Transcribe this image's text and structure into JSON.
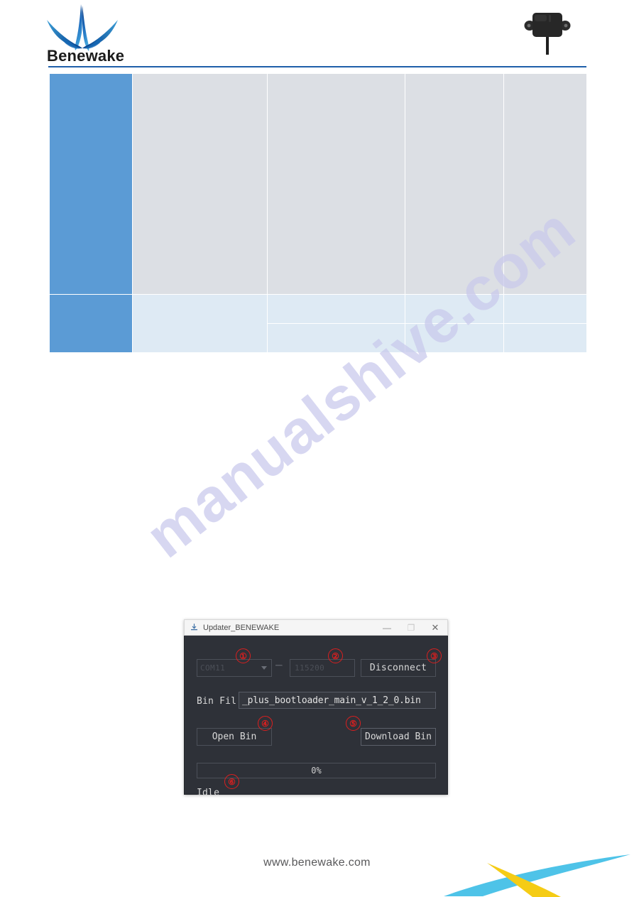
{
  "header": {
    "logo_wordmark": "Benewake",
    "logo_icon": "benewake-splash-logo",
    "device_icon": "lidar-sensor-device"
  },
  "watermark": {
    "text": "manualshive.com"
  },
  "table": {
    "columns": [
      "",
      "",
      "",
      "",
      ""
    ],
    "rows": [
      {
        "label": "",
        "cells": [
          "",
          "",
          "",
          ""
        ]
      },
      {
        "label": "",
        "cells": [
          "",
          "",
          "",
          ""
        ]
      }
    ]
  },
  "updater_dialog": {
    "title": "Updater_BENEWAKE",
    "title_icon": "updater-app-icon",
    "window_controls": {
      "minimize": "—",
      "maximize": "❐",
      "close": "✕"
    },
    "port_select": {
      "value": "COM11",
      "placeholder": "COM11"
    },
    "separator": "-",
    "baud_field": {
      "value": "115200",
      "placeholder": "115200"
    },
    "connect_button": "Disconnect",
    "bin_file_label": "Bin Fil",
    "bin_file_value": "_plus_bootloader_main_v_1_2_0.bin",
    "open_bin_button": "Open Bin",
    "download_bin_button": "Download Bin",
    "progress": {
      "percent_label": "0%",
      "value": 0
    },
    "status": "Idle",
    "markers": [
      {
        "id": "1",
        "glyph": "①",
        "target": "port-select"
      },
      {
        "id": "2",
        "glyph": "②",
        "target": "baud-field"
      },
      {
        "id": "3",
        "glyph": "③",
        "target": "disconnect-button"
      },
      {
        "id": "4",
        "glyph": "④",
        "target": "open-bin-button"
      },
      {
        "id": "5",
        "glyph": "⑤",
        "target": "download-bin-button"
      },
      {
        "id": "6",
        "glyph": "⑥",
        "target": "status-idle"
      }
    ]
  },
  "footer": {
    "url": "www.benewake.com",
    "art_icon": "benewake-swoosh-art"
  },
  "colors": {
    "brand_blue": "#1f5fa9",
    "table_accent": "#5b9bd5",
    "table_dark": "#dcdfe4",
    "table_light": "#deeaf4",
    "dialog_bg": "#2e3138",
    "marker_red": "#dc1f1f",
    "swoosh_cyan": "#4ec3e8",
    "swoosh_yellow": "#f5cc15",
    "watermark": "#c9c9ec"
  }
}
